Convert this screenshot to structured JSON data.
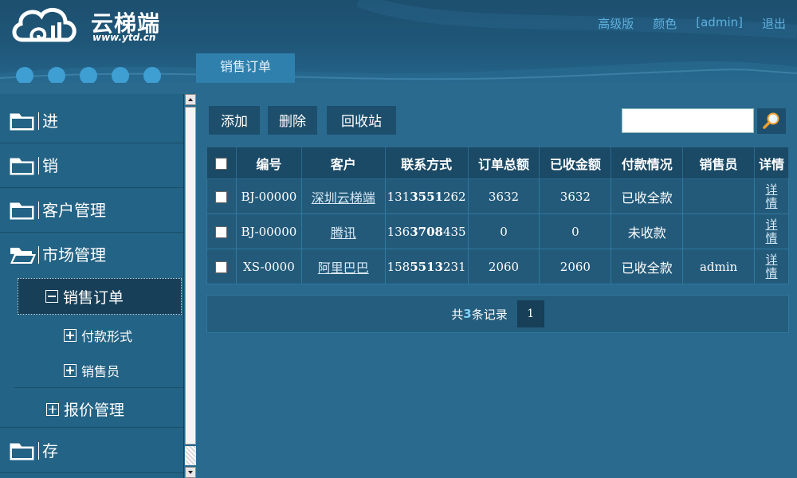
{
  "header": {
    "logo_title": "云梯端",
    "logo_url": "www.ytd.cn",
    "links": [
      "高级版",
      "颜色",
      "[admin]",
      "退出"
    ],
    "active_tab": "销售订单"
  },
  "sidebar": {
    "items": [
      {
        "label": "进"
      },
      {
        "label": "销"
      },
      {
        "label": "客户管理"
      },
      {
        "label": "市场管理"
      }
    ],
    "active_sub": "销售订单",
    "tree_children": [
      "付款形式",
      "销售员"
    ],
    "sibling": "报价管理",
    "last_item": "存"
  },
  "toolbar": {
    "add_label": "添加",
    "delete_label": "删除",
    "recycle_label": "回收站",
    "search_value": ""
  },
  "table": {
    "headers": [
      "编号",
      "客户",
      "联系方式",
      "订单总额",
      "已收金额",
      "付款情况",
      "销售员",
      "详情"
    ],
    "rows": [
      {
        "id": "BJ-00000",
        "customer": "深圳云梯端",
        "phone_a": "131",
        "phone_b": "3551",
        "phone_c": "262",
        "total": "3632",
        "received": "3632",
        "status": "已收全款",
        "sales": "",
        "detail": "详情"
      },
      {
        "id": "BJ-00000",
        "customer": "腾讯",
        "phone_a": "136",
        "phone_b": "3708",
        "phone_c": "435",
        "total": "0",
        "received": "0",
        "status": "未收款",
        "sales": "",
        "detail": "详情"
      },
      {
        "id": "XS-0000",
        "customer": "阿里巴巴",
        "phone_a": "158",
        "phone_b": "5513",
        "phone_c": "231",
        "total": "2060",
        "received": "2060",
        "status": "已收全款",
        "sales": "admin",
        "detail": "详情"
      }
    ]
  },
  "pager": {
    "prefix": "共",
    "count": "3",
    "suffix": "条记录",
    "page": "1"
  },
  "colors": {
    "background": "#2a6a8e",
    "sidebar": "#236385",
    "accent_link": "#5fb0de",
    "dots": "#3f9ed2"
  }
}
